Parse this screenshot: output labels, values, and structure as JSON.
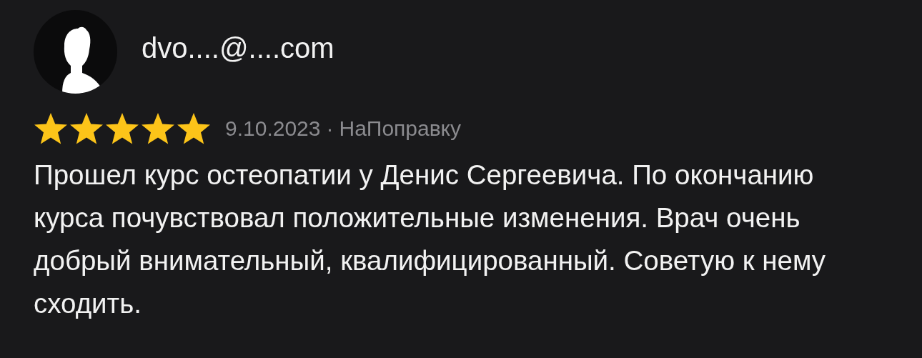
{
  "review": {
    "author": "dvo....@....com",
    "stars": 5,
    "date": "9.10.2023",
    "separator": "·",
    "source": "НаПоправку",
    "text": "Прошел курс остеопатии у Денис Сергеевича. По окончанию курса почувствовал положительные изменения. Врач очень добрый внимательный, квалифицированный. Советую к нему сходить."
  }
}
